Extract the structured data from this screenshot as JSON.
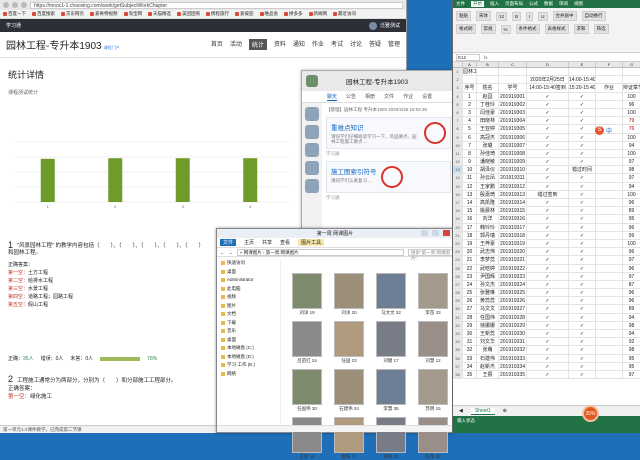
{
  "browser": {
    "address": "https://mooc1-1.chaoxing.com/work/getSubjectWorkChapter",
    "bookmarks": [
      "百度一下",
      "百度搜索",
      "京东网页",
      "爱奇特视频",
      "淘宝网",
      "天猫精选",
      "美团团购",
      "携程旅行",
      "爱彼迎",
      "唯品会",
      "拼多多",
      "新闻网",
      "最近访问"
    ],
    "site_user": "泛雅测试",
    "site_brand": "学习通"
  },
  "course": {
    "title": "园林工程-专升本1903",
    "tag": "课程门户",
    "nav": [
      "首页",
      "活动",
      "统计",
      "资料",
      "通知",
      "作业",
      "考试",
      "讨论",
      "答疑",
      "管理"
    ],
    "active_nav": "统计"
  },
  "stats": {
    "title": "统计详情",
    "subtitle": "课程测试统计"
  },
  "chart_data": {
    "type": "bar",
    "categories": [
      "1",
      "2",
      "3",
      "4"
    ],
    "values": [
      72,
      73,
      73,
      73
    ],
    "ylim": [
      0,
      100
    ],
    "color": "#6f9b2b"
  },
  "question1": {
    "num": "1",
    "text": "\"风景园林工程\" 的教学内容包括（　　）、（　　）、（　　）、（　　）、（　　）和园林工程。",
    "answer_label": "正确答案：",
    "answers": [
      {
        "label": "第一空：",
        "text": "土方工程"
      },
      {
        "label": "第二空：",
        "text": "给排水工程"
      },
      {
        "label": "第三空：",
        "text": "水景工程"
      },
      {
        "label": "第四空：",
        "text": "道路工程；园路工程"
      },
      {
        "label": "第五空：",
        "text": "假山工程"
      }
    ]
  },
  "stats_row": {
    "correct_label": "正确：",
    "correct": "35人",
    "wrong_label": "错误：",
    "wrong": "0人",
    "unanswered_label": "未答：",
    "unanswered": "0人",
    "rate": "78%"
  },
  "question2": {
    "num": "2",
    "text": "工程施工通常分为两部分，分别为（　　）和分部施工工程部分。",
    "answer_label": "正确答案：",
    "first_label": "第一空：",
    "first_text": "绿化施工"
  },
  "status_text": "第一单元1-2课件教学，已完成第二节课",
  "chat": {
    "title": "园林工程-专升本1903",
    "tabs": [
      "聊天",
      "公告",
      "相册",
      "文件",
      "作业",
      "设置"
    ],
    "active_tab": "聊天",
    "sender": "【管理】园林工程-专升本1903 2020/2/25 15:04:36",
    "cards": [
      {
        "title": "重难点知识",
        "desc": "请同学们仔细阅读学习一下，巩固要点、园林工程施工要点 ...",
        "foot": "学习通"
      },
      {
        "title": "施工图索引符号",
        "desc": "请同学们认真复习 ...",
        "foot": "学习通"
      }
    ]
  },
  "explorer": {
    "title": "第一周 网课图片",
    "ribbon": [
      "文件",
      "主页",
      "共享",
      "查看"
    ],
    "tool_tab": "图片工具",
    "path": "« 网课图片 › 第一周 网课图片",
    "search_placeholder": "搜索\"第一周 网课图片\"",
    "tree": [
      "快速访问",
      "桌面",
      "Administrator",
      "此电脑",
      "视频",
      "图片",
      "文档",
      "下载",
      "音乐",
      "桌面",
      "本地磁盘 (C:)",
      "本地磁盘 (D:)",
      "学习·工作 (E:)",
      "网络"
    ],
    "files": [
      "刘洋 19",
      "刘洋 20",
      "马文文 32",
      "李苗 33",
      "吕苗红 24",
      "任国 23",
      "刘健 17",
      "刘慧 12",
      "任国伟 30",
      "石建伟 24",
      "李慧 38",
      "苏明 15",
      "王新 16",
      "欧阳 17",
      "孙丽 22",
      "赵华 28"
    ]
  },
  "excel": {
    "tabs": [
      "文件",
      "开始",
      "插入",
      "页面布局",
      "公式",
      "数据",
      "审阅",
      "视图"
    ],
    "active_tab": "开始",
    "ribbon_row1": [
      "粘贴",
      "宋体",
      "12",
      "B",
      "I",
      "U",
      "合并居中",
      "自动换行"
    ],
    "ribbon_row2": [
      "格式刷",
      "常规",
      "%",
      "条件格式",
      "表格样式",
      "求和",
      "筛选"
    ],
    "namebox": "E12",
    "col_letters": [
      "",
      "A",
      "B",
      "C",
      "D",
      "E",
      "F",
      "G"
    ],
    "header_rows": [
      [
        "",
        "园林工程-专升本1903",
        "",
        "",
        "",
        "",
        "",
        ""
      ],
      [
        "",
        "",
        "",
        "",
        "2020年2月25日",
        "14:00-15:40",
        "",
        ""
      ],
      [
        "",
        "序号",
        "姓名",
        "学号",
        "14:00-15:40签到",
        "15:20-15:40签到",
        "作业",
        "辩证章节测试成绩"
      ]
    ],
    "rows": [
      [
        "1",
        "赵园",
        "201919301",
        "✓",
        "✓",
        "",
        "100"
      ],
      [
        "2",
        "丁桂玲",
        "201919302",
        "✓",
        "✓",
        "",
        "96"
      ],
      [
        "3",
        "闫佳豪",
        "201919303",
        "✓",
        "✓",
        "",
        "100"
      ],
      [
        "4",
        "田晓林",
        "201919304",
        "✓",
        "✓",
        "",
        "79"
      ],
      [
        "5",
        "王亚婷",
        "201919305",
        "✓",
        "✓",
        "",
        "76"
      ],
      [
        "6",
        "高冠杰",
        "201919306",
        "✓",
        "✓",
        "",
        "100"
      ],
      [
        "7",
        "张璐",
        "201919307",
        "✓",
        "✓",
        "",
        "94"
      ],
      [
        "8",
        "孙佳琦",
        "201919308",
        "✓",
        "✓",
        "",
        "100"
      ],
      [
        "9",
        "潘晓敏",
        "201919309",
        "✓",
        "✓",
        "",
        "97"
      ],
      [
        "10",
        "胡泽仪",
        "201919310",
        "✓",
        "错过时间",
        "",
        "98"
      ],
      [
        "11",
        "孙云凤",
        "201919311",
        "✓",
        "✓",
        "",
        "97"
      ],
      [
        "12",
        "王家鹏",
        "201919312",
        "✓",
        "✓",
        "",
        "94"
      ],
      [
        "13",
        "殷嘉琦",
        "201919313",
        "错过签到",
        "✓",
        "",
        "100"
      ],
      [
        "14",
        "高凯隆",
        "201919314",
        "✓",
        "✓",
        "",
        "96"
      ],
      [
        "15",
        "姚晨林",
        "201919315",
        "✓",
        "✓",
        "",
        "89"
      ],
      [
        "16",
        "刘洋",
        "201919316",
        "✓",
        "✓",
        "",
        "95"
      ],
      [
        "17",
        "韩玲玲",
        "201919317",
        "✓",
        "✓",
        "",
        "96"
      ],
      [
        "18",
        "郭丹瑞",
        "201919318",
        "✓",
        "✓",
        "",
        "99"
      ],
      [
        "19",
        "王梓豪",
        "201919319",
        "✓",
        "✓",
        "",
        "100"
      ],
      [
        "20",
        "武志伟",
        "201919320",
        "✓",
        "✓",
        "",
        "96"
      ],
      [
        "21",
        "李梦蕊",
        "201919321",
        "✓",
        "✓",
        "",
        "97"
      ],
      [
        "22",
        "武晗婷",
        "201919322",
        "✓",
        "✓",
        "",
        "96"
      ],
      [
        "23",
        "尹国辉",
        "201919323",
        "✓",
        "✓",
        "",
        "97"
      ],
      [
        "24",
        "孙文杰",
        "201919324",
        "✓",
        "✓",
        "",
        "87"
      ],
      [
        "25",
        "张雅琳",
        "201919325",
        "✓",
        "✓",
        "",
        "96"
      ],
      [
        "26",
        "黄蕊蕊",
        "201919326",
        "✓",
        "✓",
        "",
        "96"
      ],
      [
        "27",
        "马文文",
        "201919327",
        "✓",
        "✓",
        "",
        "89"
      ],
      [
        "28",
        "任国伟",
        "201919328",
        "✓",
        "✓",
        "",
        "94"
      ],
      [
        "29",
        "徐娜娜",
        "201919329",
        "✓",
        "✓",
        "",
        "98"
      ],
      [
        "30",
        "王新蕊",
        "201919330",
        "✓",
        "✓",
        "",
        "94"
      ],
      [
        "31",
        "刘文华",
        "201919331",
        "✓",
        "✓",
        "",
        "92"
      ],
      [
        "32",
        "张萌",
        "201919332",
        "✓",
        "✓",
        "",
        "98"
      ],
      [
        "33",
        "石建伟",
        "201919333",
        "✓",
        "✓",
        "",
        "95"
      ],
      [
        "34",
        "赵新杰",
        "201919334",
        "✓",
        "✓",
        "",
        "95"
      ],
      [
        "35",
        "王振",
        "201919335",
        "✓",
        "✓",
        "",
        "97"
      ]
    ],
    "highlight_row": "10",
    "sheet_tab": "Sheet1",
    "status": "输入状态",
    "net_badge": "35%"
  },
  "ime": {
    "label": "中"
  }
}
